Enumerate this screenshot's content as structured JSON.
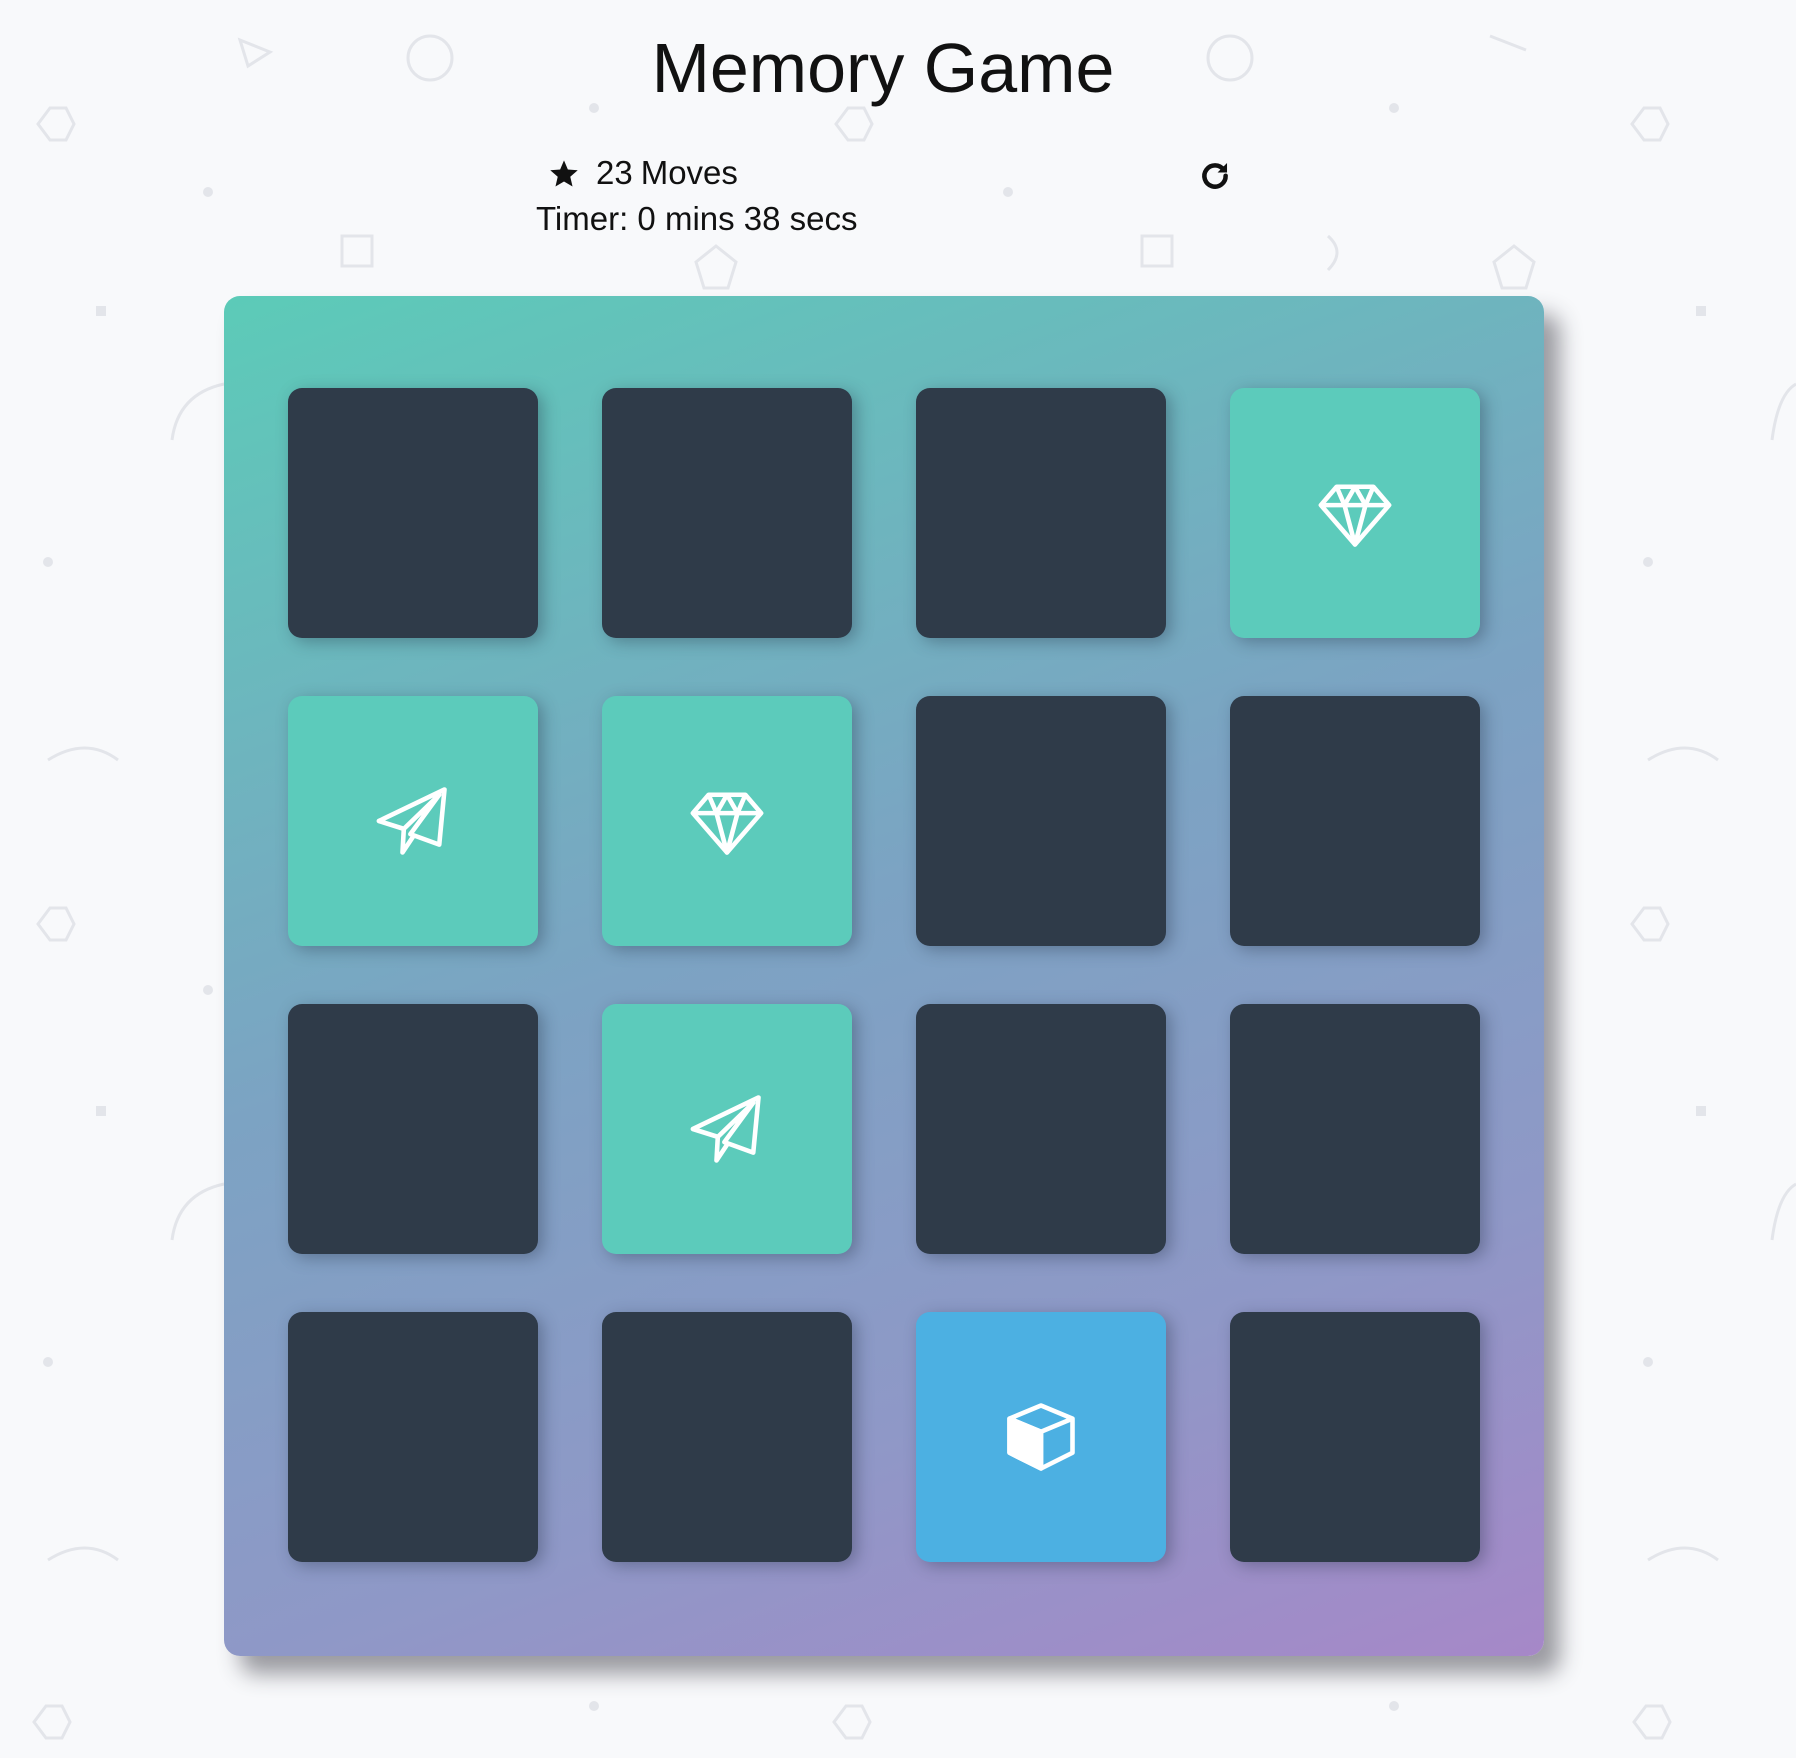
{
  "page": {
    "title": "Memory Game"
  },
  "score_panel": {
    "stars": [
      {
        "icon": "star-icon"
      }
    ],
    "moves_count": "23",
    "moves_label": "Moves",
    "timer_text": "Timer: 0 mins 38 secs",
    "restart_icon": "restart-icon"
  },
  "deck": {
    "columns": 4,
    "rows": 4,
    "cards": [
      {
        "state": "closed",
        "icon": ""
      },
      {
        "state": "closed",
        "icon": ""
      },
      {
        "state": "closed",
        "icon": ""
      },
      {
        "state": "match",
        "icon": "diamond-icon"
      },
      {
        "state": "match",
        "icon": "paper-plane-icon"
      },
      {
        "state": "match",
        "icon": "diamond-icon"
      },
      {
        "state": "closed",
        "icon": ""
      },
      {
        "state": "closed",
        "icon": ""
      },
      {
        "state": "closed",
        "icon": ""
      },
      {
        "state": "match",
        "icon": "paper-plane-icon"
      },
      {
        "state": "closed",
        "icon": ""
      },
      {
        "state": "closed",
        "icon": ""
      },
      {
        "state": "closed",
        "icon": ""
      },
      {
        "state": "closed",
        "icon": ""
      },
      {
        "state": "open",
        "icon": "cube-icon"
      },
      {
        "state": "closed",
        "icon": ""
      }
    ]
  },
  "colors": {
    "closed_card": "#2f3b49",
    "matched_card": "#5ccbbb",
    "open_card": "#4cb0e2",
    "deck_gradient_start": "#5ccbb8",
    "deck_gradient_end": "#a688c8"
  }
}
